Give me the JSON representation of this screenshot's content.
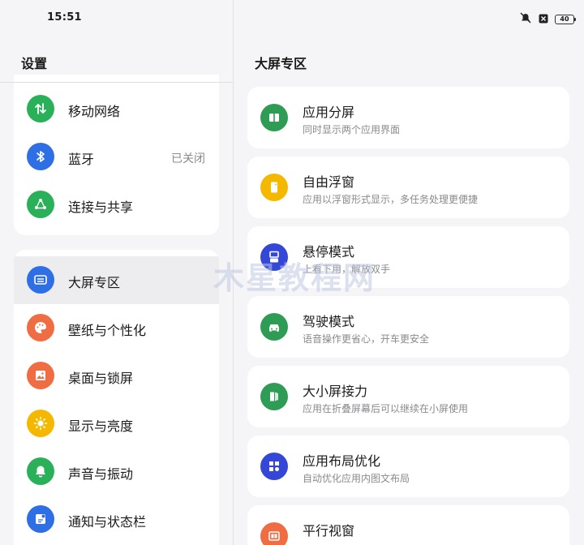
{
  "status": {
    "time": "15:51",
    "battery": "40"
  },
  "left": {
    "title": "设置",
    "group1": [
      {
        "label": "移动网络",
        "icon": "mobile-data-icon",
        "color": "#2bb05a"
      },
      {
        "label": "蓝牙",
        "icon": "bluetooth-icon",
        "color": "#2f6fe6",
        "value": "已关闭"
      },
      {
        "label": "连接与共享",
        "icon": "share-icon",
        "color": "#2bb05a"
      }
    ],
    "group2": [
      {
        "label": "大屏专区",
        "icon": "large-screen-icon",
        "color": "#2f6fe6",
        "selected": true
      },
      {
        "label": "壁纸与个性化",
        "icon": "palette-icon",
        "color": "#f06d43"
      },
      {
        "label": "桌面与锁屏",
        "icon": "picture-icon",
        "color": "#f06d43"
      },
      {
        "label": "显示与亮度",
        "icon": "sun-icon",
        "color": "#f5b800"
      },
      {
        "label": "声音与振动",
        "icon": "bell-icon",
        "color": "#2bb05a"
      },
      {
        "label": "通知与状态栏",
        "icon": "notification-icon",
        "color": "#2f6fe6"
      }
    ]
  },
  "right": {
    "title": "大屏专区",
    "cards": [
      {
        "title": "应用分屏",
        "subtitle": "同时显示两个应用界面",
        "icon": "split-screen-icon",
        "color": "#2e9c54"
      },
      {
        "title": "自由浮窗",
        "subtitle": "应用以浮窗形式显示，多任务处理更便捷",
        "icon": "floating-window-icon",
        "color": "#f5b800"
      },
      {
        "title": "悬停模式",
        "subtitle": "上看下用，解放双手",
        "icon": "hover-mode-icon",
        "color": "#3447d6"
      },
      {
        "title": "驾驶模式",
        "subtitle": "语音操作更省心，开车更安全",
        "icon": "car-icon",
        "color": "#2e9c54"
      },
      {
        "title": "大小屏接力",
        "subtitle": "应用在折叠屏幕后可以继续在小屏使用",
        "icon": "relay-icon",
        "color": "#2e9c54"
      },
      {
        "title": "应用布局优化",
        "subtitle": "自动优化应用内图文布局",
        "icon": "layout-icon",
        "color": "#3447d6"
      },
      {
        "title": "平行视窗",
        "subtitle": "",
        "icon": "parallel-window-icon",
        "color": "#f06d43"
      }
    ]
  },
  "watermark": "木星教程网"
}
